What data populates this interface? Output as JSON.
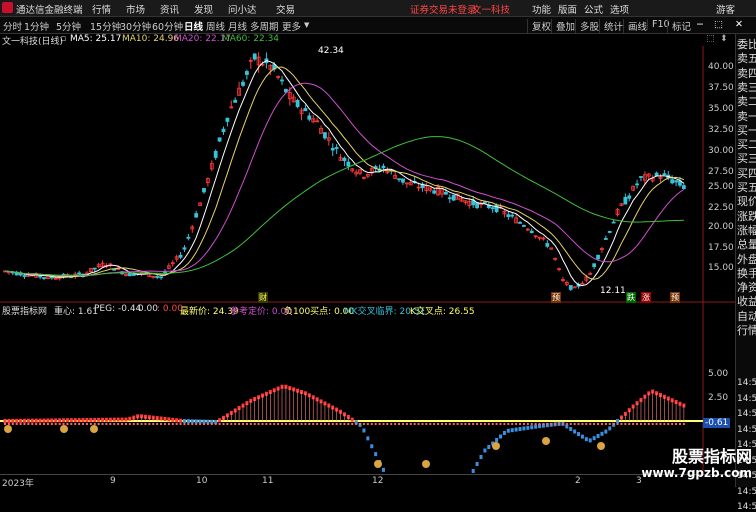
{
  "titlebar": {
    "app_name": "通达信金融终端",
    "menus": [
      "行情",
      "市场",
      "资讯",
      "发现",
      "问小达",
      "交易"
    ],
    "notice": "证券交易未登录",
    "stock": "文一科技",
    "right_menus": [
      "功能",
      "版面",
      "公式",
      "选项"
    ],
    "guest": "游客"
  },
  "toolbar": {
    "periods": [
      "分时",
      "1分钟",
      "5分钟",
      "15分钟",
      "30分钟",
      "60分钟",
      "日线",
      "周线",
      "月线",
      "多周期",
      "更多"
    ],
    "active_period": "日线",
    "right_buttons": [
      "复权",
      "叠加",
      "多股",
      "统计",
      "画线",
      "F10",
      "标记"
    ]
  },
  "ma_info": {
    "title": "文一科技(日线)",
    "ma5": "MA5: 25.17",
    "ma10": "MA10: 24.96",
    "ma20": "MA20: 22.17",
    "ma60": "MA60: 22.34"
  },
  "price_axis": {
    "labels": [
      "40.00",
      "37.50",
      "35.00",
      "32.50",
      "30.00",
      "27.50",
      "25.00",
      "22.50",
      "20.00",
      "17.50",
      "15.00"
    ]
  },
  "annotations": {
    "high": "42.34",
    "low": "12.11",
    "tags": [
      "财",
      "预",
      "跌",
      "涨",
      "预"
    ]
  },
  "indicator_info": {
    "name": "股票指标网",
    "gravity": "重心: 1.61",
    "peg": "PEG: -0.44",
    "v1": ": 0.00",
    "v2": ": 0.00",
    "latest_price": "最新价: 24.39",
    "ref_price": "参考定价: 0.00",
    "buy_point": "负100买点: 0.00",
    "cross_zone": "MK交叉临界: 20.51",
    "k_cross": "K交叉点: 26.55"
  },
  "indicator_axis": {
    "labels": [
      "5.00",
      "2.50"
    ],
    "current": "-0.61"
  },
  "date_axis": [
    "2023年",
    "9",
    "10",
    "11",
    "12",
    "2",
    "3"
  ],
  "right_panel": {
    "items": [
      "委比",
      "卖五",
      "卖四",
      "卖三",
      "卖二",
      "卖一",
      "买一",
      "买二",
      "买三",
      "买四",
      "买五",
      "现价",
      "涨跌",
      "涨幅",
      "总量",
      "外盘",
      "换手",
      "净资",
      "收益",
      "自动",
      "行情"
    ],
    "times": [
      "14:50",
      "14:50",
      "14:50",
      "14:50",
      "14:50",
      "14:50",
      "14:50",
      "14:50",
      "14:50"
    ]
  },
  "watermark": {
    "line1": "股票指标网",
    "line2": "www.7gpzb.com"
  },
  "colors": {
    "up": "#ff3b3b",
    "down": "#36c2d8",
    "ma5": "#ffffff",
    "ma10": "#e6d36a",
    "ma20": "#d04fd0",
    "ma60": "#3fbf3f",
    "cross_line": "#ffff66"
  }
}
